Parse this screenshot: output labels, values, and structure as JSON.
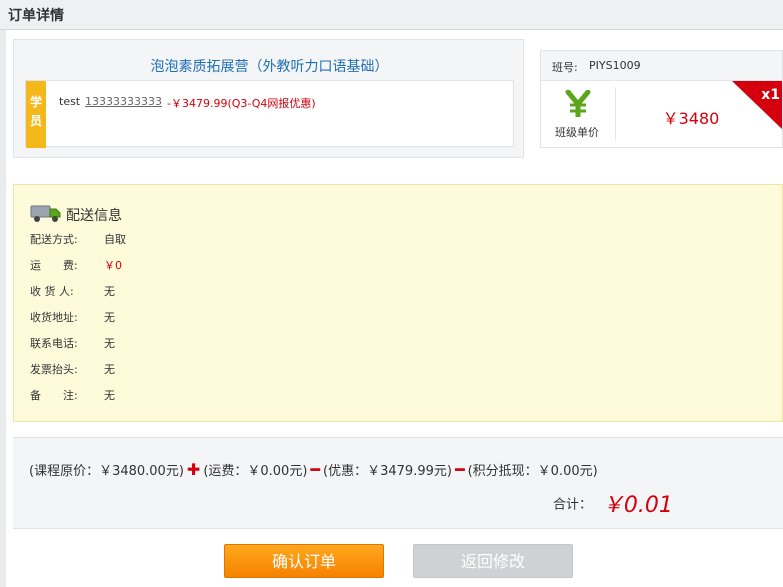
{
  "page": {
    "title": "订单详情"
  },
  "course": {
    "title": "泡泡素质拓展营（外教听力口语基础）",
    "student_tag": "学员",
    "student_name": "test",
    "student_phone": "13333333333",
    "discount_text": "-￥3479.99(Q3-Q4网报优惠)"
  },
  "class_info": {
    "code_label": "班号:",
    "code_value": "PIYS1009",
    "unit_label": "班级单价",
    "price": "￥3480",
    "quantity": "x1",
    "icon": "yen-icon"
  },
  "delivery": {
    "icon": "truck-icon",
    "title": "配送信息",
    "rows": [
      {
        "label": "配送方式:",
        "value": "自取"
      },
      {
        "label": "运　　费:",
        "value": "￥0"
      },
      {
        "label": "收 货 人:",
        "value": "无"
      },
      {
        "label": "收货地址:",
        "value": "无"
      },
      {
        "label": "联系电话:",
        "value": "无"
      },
      {
        "label": "发票抬头:",
        "value": "无"
      },
      {
        "label": "备　　注:",
        "value": "无"
      }
    ]
  },
  "summary": {
    "original_price": "(课程原价：￥3480.00元)",
    "shipping": "(运费：￥0.00元)",
    "discount": "(优惠：￥3479.99元)",
    "points": "(积分抵现：￥0.00元)",
    "total_label": "合计：",
    "total_value": "￥0.01"
  },
  "buttons": {
    "confirm": "确认订单",
    "back": "返回修改"
  },
  "colors": {
    "accent_red": "#d4000d",
    "link_blue": "#1f6fb8",
    "button_orange": "#f58200",
    "tag_yellow": "#f5b81b"
  }
}
